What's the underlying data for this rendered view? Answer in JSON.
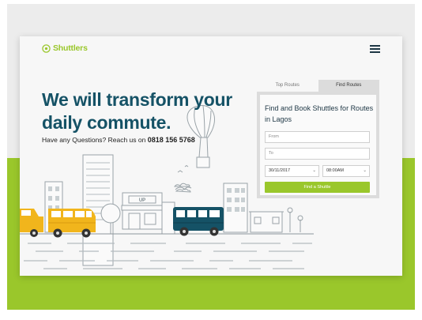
{
  "brand": {
    "name": "Shuttlers",
    "accent": "#9ac72b",
    "dark": "#155266"
  },
  "nav": {
    "menu_icon": "hamburger-menu-icon"
  },
  "hero": {
    "title_line1": "We will transform your",
    "title_line2": "daily commute.",
    "subtitle": "Have any Questions? Reach us on ",
    "phone": "0818 156 5768"
  },
  "illustration": {
    "sign_text": "UP"
  },
  "booking": {
    "tabs": [
      {
        "label": "Top Routes",
        "active": false
      },
      {
        "label": "Find Routes",
        "active": true
      }
    ],
    "title": "Find and Book Shuttles for Routes in Lagos",
    "from_placeholder": "From",
    "to_placeholder": "To",
    "date_value": "30/11/2017",
    "time_value": "08:00AM",
    "button_label": "Find a Shuttle"
  }
}
